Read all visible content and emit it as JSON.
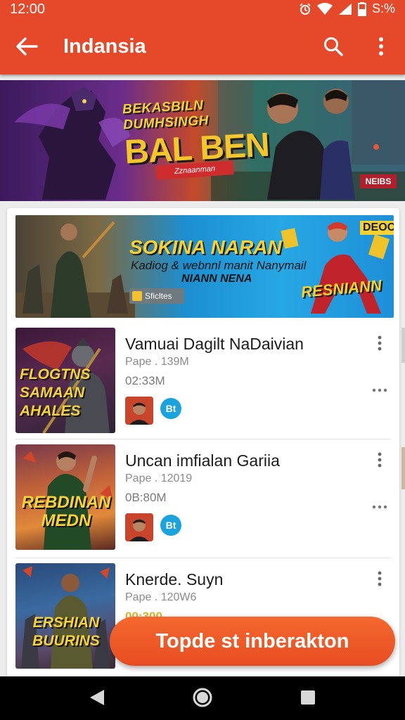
{
  "status": {
    "time": "12:00",
    "battery_text": "S:%",
    "icons": [
      "alarm-icon",
      "wifi-icon",
      "signal-icon",
      "battery-icon"
    ]
  },
  "appbar": {
    "title": "Indansia",
    "back_icon": "arrow-left-icon",
    "search_icon": "search-icon",
    "menu_icon": "more-vertical-icon",
    "color": "#e6492a"
  },
  "hero": {
    "line1": "BEKASBILN",
    "line2": "DUMHSINGH",
    "big": "BAL BEN",
    "ribbon": "Zznaanman",
    "badge": "NEIBS"
  },
  "promo": {
    "title": "SOKINA NARAN",
    "subtitle": "Kadiog & webnnl manit Nanymail",
    "subtitle2": "NIANN NENA",
    "right_text": "RESNIANN",
    "deco": "DEOO",
    "chip_label": "Sficltes"
  },
  "items": [
    {
      "thumb_text": "FLOGTNS SAMAAN AHALES",
      "title": "Vamuai Dagilt NaDaivian",
      "meta": "Pape . 139M",
      "time": "02:33M",
      "badge": "Bt"
    },
    {
      "thumb_text": "REBDINAN MEDN",
      "title": "Uncan imfialan Gariia",
      "meta": "Pape . 12019",
      "time": "0B:80M",
      "badge": "Bt"
    },
    {
      "thumb_text": "ERSHIAN BUURINS",
      "title": "Knerde. Suyn",
      "meta": "Pape . 120W6",
      "time": "00:300",
      "badge": ""
    }
  ],
  "cta": {
    "label": "Topde st inberakton",
    "color": "#e84d22"
  },
  "navbar": {
    "icons": [
      "nav-back-icon",
      "nav-home-icon",
      "nav-recents-icon"
    ]
  }
}
